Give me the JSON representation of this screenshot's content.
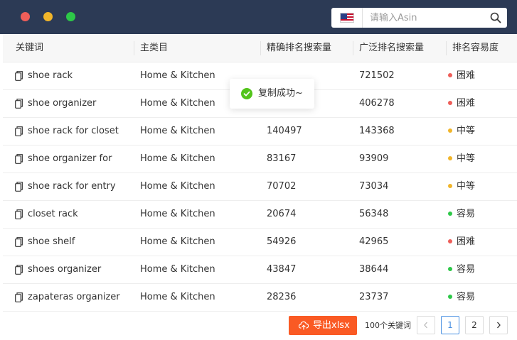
{
  "window": {
    "controls": [
      "close",
      "minimize",
      "zoom"
    ]
  },
  "search": {
    "placeholder": "请输入Asin",
    "value": "",
    "marketplace_flag": "us-flag-icon"
  },
  "table": {
    "columns": [
      "关键词",
      "主类目",
      "精确排名搜索量",
      "广泛排名搜索量",
      "排名容易度"
    ],
    "rows": [
      {
        "keyword": "shoe rack",
        "category": "Home & Kitchen",
        "exact": "",
        "broad": "721502",
        "difficulty": "困难",
        "level": "hard"
      },
      {
        "keyword": "shoe organizer",
        "category": "Home & Kitchen",
        "exact": "",
        "broad": "406278",
        "difficulty": "困难",
        "level": "hard"
      },
      {
        "keyword": "shoe rack for closet",
        "category": "Home & Kitchen",
        "exact": "140497",
        "broad": "143368",
        "difficulty": "中等",
        "level": "medium"
      },
      {
        "keyword": "shoe organizer for",
        "category": "Home & Kitchen",
        "exact": "83167",
        "broad": "93909",
        "difficulty": "中等",
        "level": "medium"
      },
      {
        "keyword": "shoe rack for entry",
        "category": "Home & Kitchen",
        "exact": "70702",
        "broad": "73034",
        "difficulty": "中等",
        "level": "medium"
      },
      {
        "keyword": "closet rack",
        "category": "Home & Kitchen",
        "exact": "20674",
        "broad": "56348",
        "difficulty": "容易",
        "level": "easy"
      },
      {
        "keyword": "shoe shelf",
        "category": "Home & Kitchen",
        "exact": "54926",
        "broad": "42965",
        "difficulty": "困难",
        "level": "hard"
      },
      {
        "keyword": "shoes organizer",
        "category": "Home & Kitchen",
        "exact": "43847",
        "broad": "38644",
        "difficulty": "容易",
        "level": "easy"
      },
      {
        "keyword": "zapateras organizer",
        "category": "Home & Kitchen",
        "exact": "28236",
        "broad": "23737",
        "difficulty": "容易",
        "level": "easy"
      }
    ]
  },
  "difficulty_colors": {
    "hard": "#ee5e59",
    "medium": "#f1b52a",
    "easy": "#2dc848"
  },
  "toast": {
    "message": "复制成功~",
    "color": "#52c41a"
  },
  "footer": {
    "export_label": "导出xlsx",
    "total_label": "100个关键词",
    "pages": [
      "1",
      "2"
    ],
    "current_page": "1"
  },
  "colors": {
    "titlebar": "#2c3a55",
    "accent": "#fa5a24",
    "pagination_active": "#4a90e2"
  }
}
